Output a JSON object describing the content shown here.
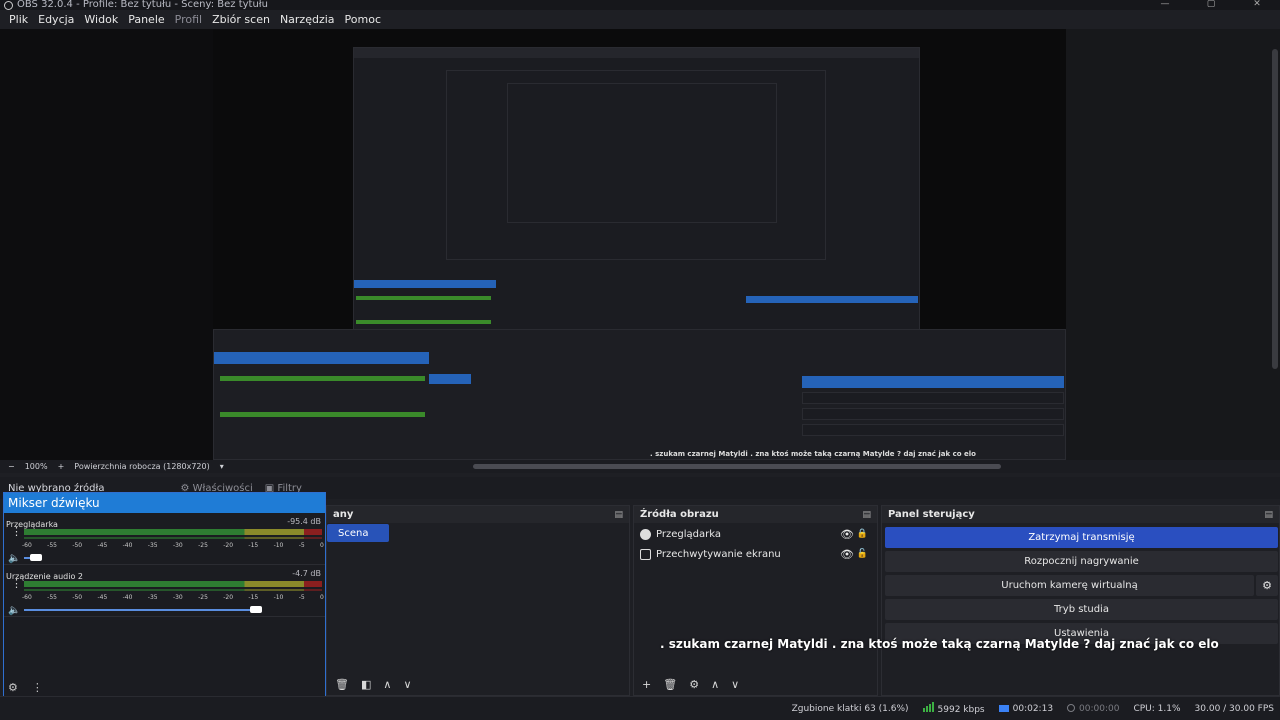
{
  "window": {
    "title": "OBS 32.0.4 - Profile: Bez tytułu - Sceny: Bez tytułu"
  },
  "menu": [
    {
      "label": "Plik"
    },
    {
      "label": "Edycja"
    },
    {
      "label": "Widok"
    },
    {
      "label": "Panele"
    },
    {
      "label": "Profil",
      "dim": true
    },
    {
      "label": "Zbiór scen"
    },
    {
      "label": "Narzędzia"
    },
    {
      "label": "Pomoc"
    }
  ],
  "preview": {
    "zoom": "100%",
    "add": "+",
    "workspace": "Powierzchnia robocza (1280x720)",
    "dropdown": "▾"
  },
  "no_source": {
    "label": "Nie wybrano źródła",
    "properties": "Właściwości",
    "filters": "Filtry"
  },
  "mixer": {
    "title": "Mikser dźwięku",
    "channels": [
      {
        "name": "Przeglądarka",
        "db": "-95.4 dB",
        "level": 0.02
      },
      {
        "name": "Urządzenie audio 2",
        "db": "-4.7 dB",
        "level": 0.78
      }
    ],
    "ticks": [
      "-60",
      "-55",
      "-50",
      "-45",
      "-40",
      "-35",
      "-30",
      "-25",
      "-20",
      "-15",
      "-10",
      "-5",
      "0"
    ]
  },
  "scenes": {
    "title_fragment": "any",
    "items": [
      "Scena"
    ]
  },
  "sources": {
    "title": "Źródła obrazu",
    "items": [
      {
        "name": "Przeglądarka",
        "icon": "globe-icon"
      },
      {
        "name": "Przechwytywanie ekranu",
        "icon": "monitor-icon"
      }
    ]
  },
  "controls": {
    "title": "Panel sterujący",
    "buttons": [
      {
        "label": "Zatrzymaj transmisję",
        "active": true
      },
      {
        "label": "Rozpocznij nagrywanie"
      },
      {
        "label": "Uruchom kamerę wirtualną"
      },
      {
        "label": "Tryb studia"
      },
      {
        "label": "Ustawienia"
      }
    ]
  },
  "overlay_text": ". szukam czarnej Matyldi . zna ktoś może taką czarną Matylde ? daj znać jak co elo",
  "status": {
    "dropped": "Zgubione klatki 63 (1.6%)",
    "bitrate": "5992 kbps",
    "stream_time": "00:02:13",
    "rec_time": "00:00:00",
    "cpu": "CPU: 1.1%",
    "fps": "30.00 / 30.00 FPS"
  },
  "colors": {
    "accent": "#2a4fc0",
    "mixer_title": "#1f7cd6",
    "meter_green": "#2e7d32"
  }
}
